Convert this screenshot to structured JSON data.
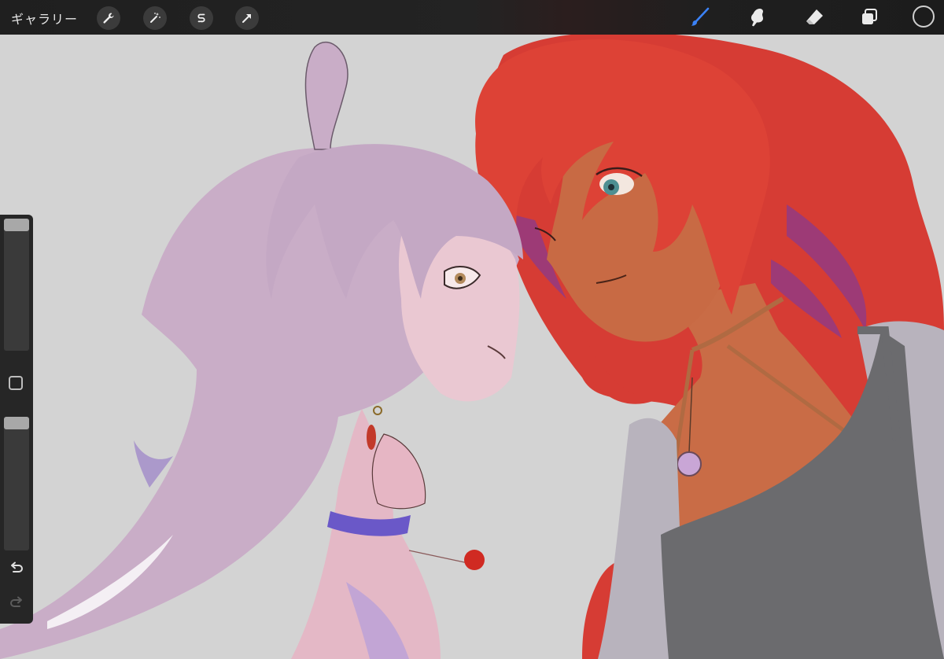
{
  "toolbar": {
    "gallery_label": "ギャラリー",
    "left_tools": [
      {
        "name": "actions",
        "icon": "wrench-icon"
      },
      {
        "name": "adjustments",
        "icon": "magic-wand-icon"
      },
      {
        "name": "selection",
        "icon": "selection-s-icon"
      },
      {
        "name": "transform",
        "icon": "arrow-cursor-icon"
      }
    ],
    "right_tools": [
      {
        "name": "brush",
        "icon": "brush-icon",
        "active": true
      },
      {
        "name": "smudge",
        "icon": "smudge-icon"
      },
      {
        "name": "eraser",
        "icon": "eraser-icon"
      },
      {
        "name": "layers",
        "icon": "layers-icon"
      },
      {
        "name": "color",
        "icon": "color-circle-icon"
      }
    ]
  },
  "sidebar": {
    "brush_size_level": 1.0,
    "opacity_level": 1.0,
    "modify_icon": "square-icon",
    "undo_icon": "undo-icon",
    "redo_icon": "redo-icon"
  },
  "colors": {
    "toolbar_bg": "#1f1f1f",
    "canvas_bg": "#d3d3d3",
    "active_tool": "#3b82f6",
    "sidebar_bg": "#262626"
  }
}
